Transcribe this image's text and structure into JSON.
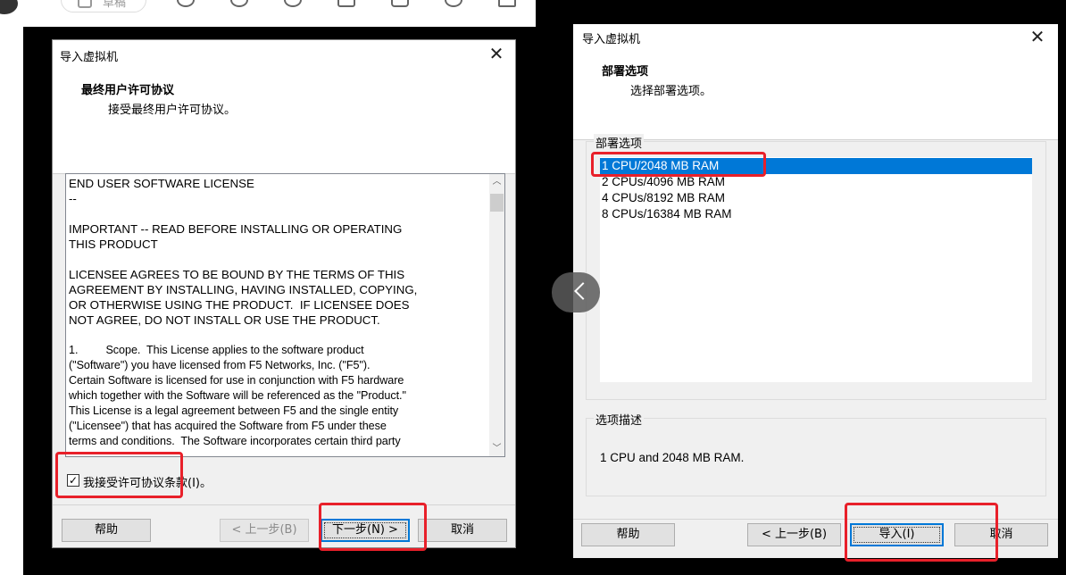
{
  "left_dialog": {
    "title": "导入虚拟机",
    "close": "✕",
    "heading": "最终用户许可协议",
    "subheading": "接受最终用户许可协议。",
    "license_lines": [
      "END USER SOFTWARE LICENSE",
      "--",
      "",
      "IMPORTANT -- READ BEFORE INSTALLING OR OPERATING",
      "THIS PRODUCT",
      "",
      "LICENSEE AGREES TO BE BOUND BY THE TERMS OF THIS",
      "AGREEMENT BY INSTALLING, HAVING INSTALLED, COPYING,",
      "OR OTHERWISE USING THE PRODUCT.  IF LICENSEE DOES",
      "NOT AGREE, DO NOT INSTALL OR USE THE PRODUCT.",
      "",
      "1.         Scope.  This License applies to the software product",
      "(\"Software\") you have licensed from F5 Networks, Inc. (\"F5\").",
      "Certain Software is licensed for use in conjunction with F5 hardware",
      "which together with the Software will be referenced as the \"Product.\"",
      "This License is a legal agreement between F5 and the single entity",
      "(\"Licensee\") that has acquired the Software from F5 under these",
      "terms and conditions.  The Software incorporates certain third party"
    ],
    "accept_checkbox": {
      "label": "我接受许可协议条款(I)。",
      "checked": true,
      "mark": "✓"
    },
    "buttons": {
      "help": "帮助",
      "back": "< 上一步(B)",
      "next": "下一步(N) >",
      "cancel": "取消"
    }
  },
  "right_dialog": {
    "title": "导入虚拟机",
    "close": "✕",
    "heading": "部署选项",
    "subheading": "选择部署选项。",
    "options_group_label": "部署选项",
    "options": [
      "1 CPU/2048 MB RAM",
      "2 CPUs/4096 MB RAM",
      "4 CPUs/8192 MB RAM",
      "8 CPUs/16384 MB RAM"
    ],
    "selected_index": 0,
    "description_group_label": "选项描述",
    "description": "1 CPU and 2048 MB RAM.",
    "buttons": {
      "help": "帮助",
      "back": "< 上一步(B)",
      "import": "导入(I)",
      "cancel": "取消"
    }
  },
  "top_toolbar": {
    "draft_label": "草稿"
  },
  "colors": {
    "selection": "#0078d7",
    "highlight": "#e8202a"
  }
}
